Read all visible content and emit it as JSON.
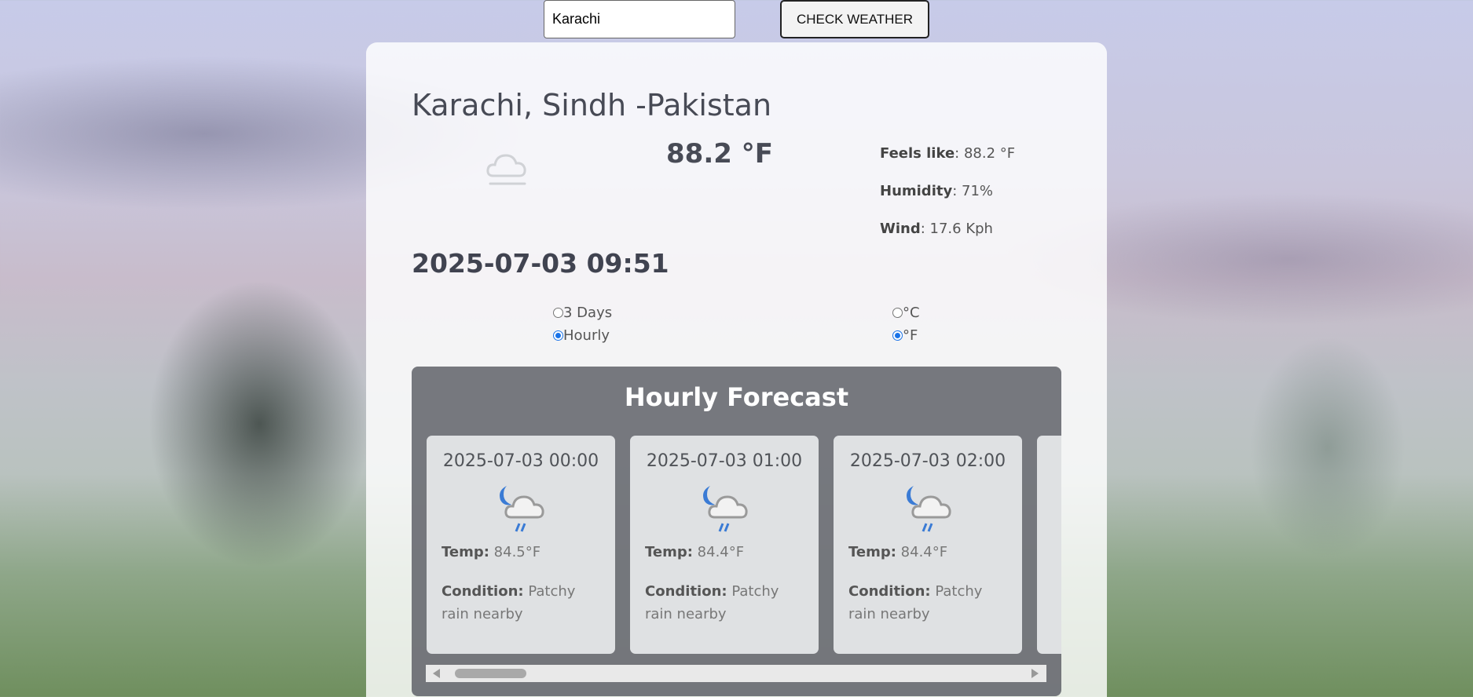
{
  "search": {
    "value": "Karachi"
  },
  "check_button": {
    "label": "CHECK WEATHER"
  },
  "current": {
    "location": "Karachi, Sindh -Pakistan",
    "temperature": "88.2 °F",
    "condition_icon": "cloud-icon",
    "feels_like_label": "Feels like",
    "feels_like_value": ": 88.2 °F",
    "humidity_label": "Humidity",
    "humidity_value": ": 71%",
    "wind_label": "Wind",
    "wind_value": ": 17.6 Kph",
    "datetime": "2025-07-03 09:51"
  },
  "view_options": [
    {
      "label": "3 Days",
      "checked": false
    },
    {
      "label": "Hourly",
      "checked": true
    }
  ],
  "unit_options": [
    {
      "label": "°C",
      "checked": false
    },
    {
      "label": "°F",
      "checked": true
    }
  ],
  "forecast": {
    "title": "Hourly Forecast",
    "temp_label": "Temp:",
    "condition_label": "Condition:",
    "items": [
      {
        "time": "2025-07-03 00:00",
        "temp": "84.5°F",
        "condition": "Patchy rain nearby",
        "icon": "night-rain-icon"
      },
      {
        "time": "2025-07-03 01:00",
        "temp": "84.4°F",
        "condition": "Patchy rain nearby",
        "icon": "night-rain-icon"
      },
      {
        "time": "2025-07-03 02:00",
        "temp": "84.4°F",
        "condition": "Patchy rain nearby",
        "icon": "night-rain-icon"
      }
    ]
  },
  "colors": {
    "radio_checked": "#1a73e8",
    "forecast_panel": "#5f6268",
    "text_dark": "#474a55"
  }
}
